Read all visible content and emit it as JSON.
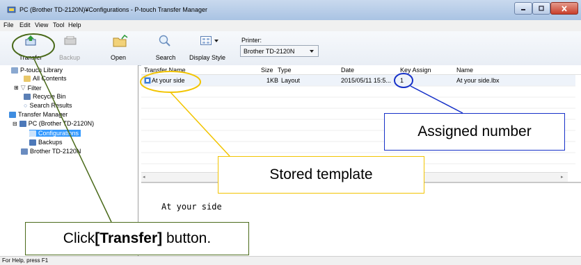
{
  "window": {
    "title": "PC (Brother TD-2120N)¥Configurations - P-touch Transfer Manager"
  },
  "menu": [
    "File",
    "Edit",
    "View",
    "Tool",
    "Help"
  ],
  "toolbar": {
    "transfer": "Transfer",
    "backup": "Backup",
    "open": "Open",
    "search": "Search",
    "display_style": "Display Style",
    "printer_label": "Printer:",
    "printer_value": "Brother TD-2120N"
  },
  "tree": {
    "library": "P-touch Library",
    "all_contents": "All Contents",
    "filter": "Filter",
    "recycle_bin": "Recycle Bin",
    "search_results": "Search Results",
    "transfer_manager": "Transfer Manager",
    "pc": "PC (Brother TD-2120N)",
    "configurations": "Configurations",
    "backups": "Backups",
    "printer": "Brother TD-2120N"
  },
  "table": {
    "headers": [
      "Transfer Name",
      "Size",
      "Type",
      "Date",
      "Key Assign",
      "Name"
    ],
    "rows": [
      {
        "transfer_name": "At your side",
        "size": "1KB",
        "type": "Layout",
        "date": "2015/05/11 15:5...",
        "key_assign": "1",
        "name": "At your side.lbx"
      }
    ]
  },
  "preview": {
    "text": "At your side"
  },
  "status": {
    "text": "For Help, press F1"
  },
  "annotations": {
    "assigned_number": "Assigned number",
    "stored_template": "Stored template",
    "click_transfer_prefix": "Click",
    "click_transfer_bold": "[Transfer]",
    "click_transfer_suffix": " button."
  },
  "colors": {
    "callout_green": "#4a6a1a",
    "callout_yellow": "#f2c400",
    "callout_blue": "#1530c8",
    "selection": "#3399ff"
  }
}
